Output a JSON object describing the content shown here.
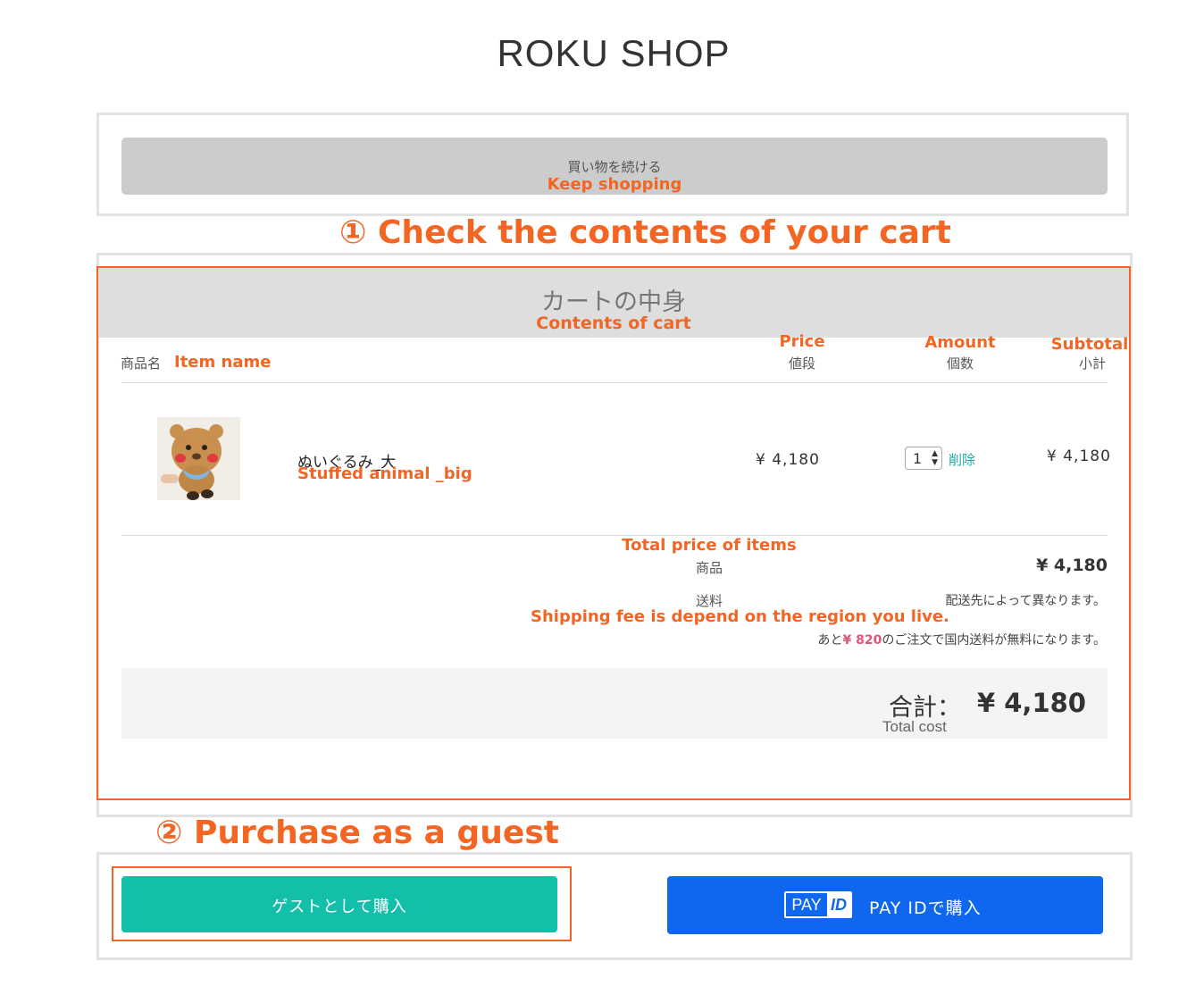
{
  "shop": {
    "title": "ROKU SHOP"
  },
  "keep_shopping": {
    "label_jp": "買い物を続ける",
    "label_en": "Keep shopping"
  },
  "annotations": {
    "step1": "① Check the contents of your cart",
    "step2": "② Purchase as a guest",
    "accent_color": "#f26522"
  },
  "cart": {
    "title_jp": "カートの中身",
    "title_en": "Contents of cart",
    "columns": {
      "item": {
        "jp": "商品名",
        "en": "Item name"
      },
      "price": {
        "jp": "値段",
        "en": "Price"
      },
      "amount": {
        "jp": "個数",
        "en": "Amount"
      },
      "subtotal": {
        "jp": "小計",
        "en": "Subtotal"
      }
    },
    "items": [
      {
        "name_jp": "ぬいぐるみ_大",
        "name_en": "Stuffed animal _big",
        "price": "¥ 4,180",
        "quantity": "1",
        "delete_label": "削除",
        "subtotal": "¥ 4,180",
        "image": "stuffed-animal-photo"
      }
    ],
    "summary": {
      "items_total_en": "Total price of items",
      "items_label_jp": "商品",
      "items_total": "¥ 4,180",
      "shipping_label_jp": "送料",
      "shipping_value_jp": "配送先によって異なります。",
      "shipping_note_en": "Shipping fee is depend on the region you live.",
      "free_ship_prefix": "あと",
      "free_ship_amount": "¥ 820",
      "free_ship_suffix": "のご注文で国内送料が無料になります。",
      "total_label_jp": "合計：",
      "total_label_en": "Total cost",
      "total_value": "¥ 4,180"
    }
  },
  "purchase": {
    "guest_label": "ゲストとして購入",
    "guest_color": "#14bfaa",
    "payid_logo_left": "PAY",
    "payid_logo_right": "ID",
    "payid_label": "PAY IDで購入",
    "payid_color": "#0f67f0"
  }
}
